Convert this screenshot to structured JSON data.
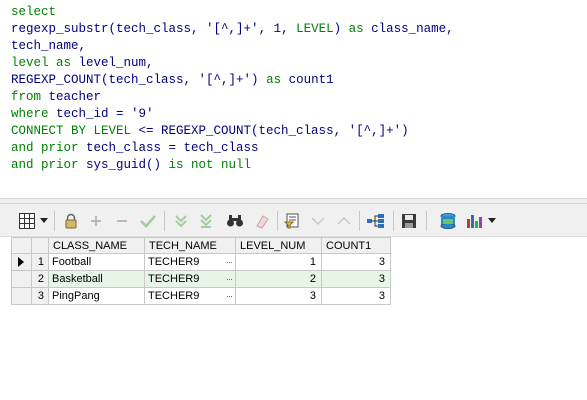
{
  "editor": {
    "lines": [
      {
        "segments": [
          {
            "t": "select",
            "c": "kw"
          }
        ]
      },
      {
        "segments": [
          {
            "t": "regexp_substr(tech_class, ",
            "c": "ident"
          },
          {
            "t": "'[^,]+'",
            "c": "str"
          },
          {
            "t": ", ",
            "c": "ident"
          },
          {
            "t": "1",
            "c": "num"
          },
          {
            "t": ", ",
            "c": "ident"
          },
          {
            "t": "LEVEL",
            "c": "kw"
          },
          {
            "t": ") ",
            "c": "ident"
          },
          {
            "t": "as",
            "c": "kw"
          },
          {
            "t": " class_name,",
            "c": "ident"
          }
        ]
      },
      {
        "segments": [
          {
            "t": "tech_name,",
            "c": "ident"
          }
        ]
      },
      {
        "segments": [
          {
            "t": "level",
            "c": "kw"
          },
          {
            "t": " ",
            "c": "ident"
          },
          {
            "t": "as",
            "c": "kw"
          },
          {
            "t": " level_num,",
            "c": "ident"
          }
        ]
      },
      {
        "segments": [
          {
            "t": "REGEXP_COUNT(tech_class, ",
            "c": "ident"
          },
          {
            "t": "'[^,]+'",
            "c": "str"
          },
          {
            "t": ") ",
            "c": "ident"
          },
          {
            "t": "as",
            "c": "kw"
          },
          {
            "t": " count1",
            "c": "ident"
          }
        ]
      },
      {
        "segments": [
          {
            "t": "from",
            "c": "kw"
          },
          {
            "t": " teacher",
            "c": "ident"
          }
        ]
      },
      {
        "segments": [
          {
            "t": "where",
            "c": "kw"
          },
          {
            "t": " tech_id = ",
            "c": "ident"
          },
          {
            "t": "'9'",
            "c": "str"
          }
        ]
      },
      {
        "segments": [
          {
            "t": "CONNECT BY LEVEL",
            "c": "kw"
          },
          {
            "t": " <= REGEXP_COUNT(tech_class, ",
            "c": "ident"
          },
          {
            "t": "'[^,]+'",
            "c": "str"
          },
          {
            "t": ")",
            "c": "ident"
          }
        ]
      },
      {
        "segments": [
          {
            "t": "and prior",
            "c": "kw"
          },
          {
            "t": " tech_class = tech_class",
            "c": "ident"
          }
        ]
      },
      {
        "segments": [
          {
            "t": "and prior",
            "c": "kw"
          },
          {
            "t": " sys_guid() ",
            "c": "ident"
          },
          {
            "t": "is not null",
            "c": "kw"
          }
        ]
      }
    ]
  },
  "colors": {
    "keyword": "#008000",
    "identifier": "#000080",
    "selected_row": "#e6f5e6"
  },
  "toolbar": {
    "icons": [
      "grid-view-icon",
      "dropdown-arrow-icon",
      "lock-icon",
      "add-record-icon",
      "delete-record-icon",
      "post-icon",
      "fetch-next-icon",
      "fetch-last-icon",
      "find-icon",
      "clear-icon",
      "query-by-example-icon",
      "filter-down-icon",
      "filter-up-icon",
      "tree-icon",
      "save-icon",
      "export-icon",
      "chart-icon",
      "chart-dropdown-icon"
    ]
  },
  "grid": {
    "columns": [
      "CLASS_NAME",
      "TECH_NAME",
      "LEVEL_NUM",
      "COUNT1"
    ],
    "rows": [
      {
        "num": "1",
        "class_name": "Football",
        "tech_name": "TECHER9",
        "level_num": "1",
        "count1": "3"
      },
      {
        "num": "2",
        "class_name": "Basketball",
        "tech_name": "TECHER9",
        "level_num": "2",
        "count1": "3"
      },
      {
        "num": "3",
        "class_name": "PingPang",
        "tech_name": "TECHER9",
        "level_num": "3",
        "count1": "3"
      }
    ],
    "ellipsis": "···"
  }
}
